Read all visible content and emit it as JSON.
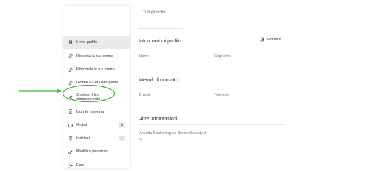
{
  "sidebar": {
    "items": [
      {
        "label": "Il mio profilo",
        "icon": "user-icon",
        "active": true
      },
      {
        "label": "Riordina la tua crema",
        "icon": "link-icon"
      },
      {
        "label": "Riformula la tua crema",
        "icon": "link-icon"
      },
      {
        "label": "Ordina il Gel Detergente",
        "icon": "link-icon"
      },
      {
        "label": "Gestisci il tuo abbonamento",
        "icon": "link-icon"
      },
      {
        "label": "Bonnie ti premia",
        "icon": "document-icon"
      },
      {
        "label": "Ordini",
        "icon": "wallet-icon",
        "badge": "0"
      },
      {
        "label": "Indirizzi",
        "icon": "location-pin-icon",
        "badge": "1"
      },
      {
        "label": "Modifica password",
        "icon": "key-icon"
      },
      {
        "label": "Esci",
        "icon": "logout-icon"
      }
    ]
  },
  "orders_card": {
    "label": "Tutti gli ordini"
  },
  "profile": {
    "title": "Informazioni profilo",
    "edit_label": "Modifica",
    "name_label": "Nome",
    "surname_label": "Cognome"
  },
  "contacts": {
    "title": "Metodi di contatto",
    "email_label": "E-mail",
    "phone_label": "Telefono"
  },
  "other": {
    "title": "Altre informazioni",
    "marketing_label": "Accetta Marketing da BonnieBeauty.it",
    "marketing_value": "Sì"
  },
  "colors": {
    "annotation": "#3dbb2f",
    "active_bg": "#eaeaea"
  }
}
